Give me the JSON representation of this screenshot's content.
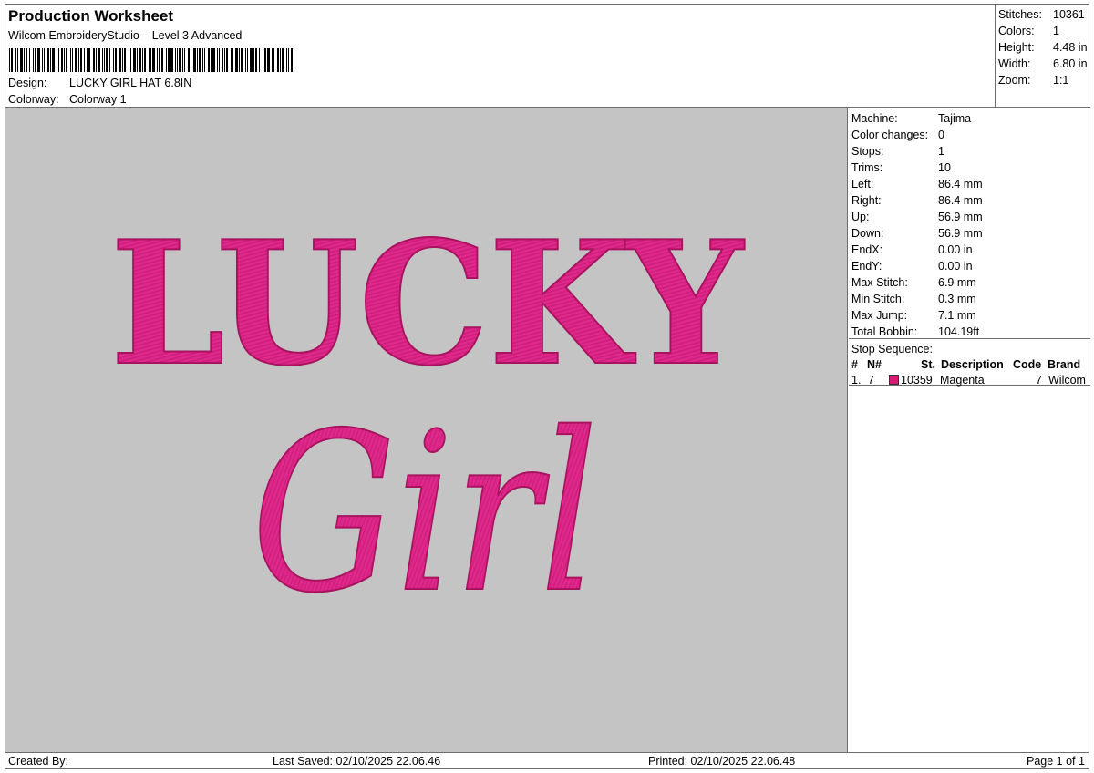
{
  "header": {
    "title": "Production Worksheet",
    "software": "Wilcom EmbroideryStudio – Level 3 Advanced",
    "design_label": "Design:",
    "design_value": "LUCKY GIRL HAT 6.8IN",
    "colorway_label": "Colorway:",
    "colorway_value": "Colorway 1"
  },
  "summary": [
    {
      "label": "Stitches:",
      "value": "10361"
    },
    {
      "label": "Colors:",
      "value": "1"
    },
    {
      "label": "Height:",
      "value": "4.48 in"
    },
    {
      "label": "Width:",
      "value": "6.80 in"
    },
    {
      "label": "Zoom:",
      "value": "1:1"
    }
  ],
  "preview": {
    "line1": "LUCKY",
    "line2": "Girl",
    "thread_color": "#e0278a",
    "background_color": "#c4c4c4"
  },
  "machine_info": [
    {
      "label": "Machine:",
      "value": "Tajima"
    },
    {
      "label": "Color changes:",
      "value": "0"
    },
    {
      "label": "Stops:",
      "value": "1"
    },
    {
      "label": "Trims:",
      "value": "10"
    },
    {
      "label": "Left:",
      "value": "86.4 mm"
    },
    {
      "label": "Right:",
      "value": "86.4 mm"
    },
    {
      "label": "Up:",
      "value": "56.9 mm"
    },
    {
      "label": "Down:",
      "value": "56.9 mm"
    },
    {
      "label": "EndX:",
      "value": "0.00 in"
    },
    {
      "label": "EndY:",
      "value": "0.00 in"
    },
    {
      "label": "Max Stitch:",
      "value": "6.9 mm"
    },
    {
      "label": "Min Stitch:",
      "value": "0.3 mm"
    },
    {
      "label": "Max Jump:",
      "value": "7.1 mm"
    },
    {
      "label": "Total Bobbin:",
      "value": "104.19ft"
    }
  ],
  "stop_sequence": {
    "title": "Stop Sequence:",
    "columns": {
      "num": "#",
      "n": "N#",
      "st": "St.",
      "description": "Description",
      "code": "Code",
      "brand": "Brand"
    },
    "rows": [
      {
        "num": "1.",
        "n": "7",
        "swatch": "#d81b72",
        "st": "10359",
        "description": "Magenta",
        "code": "7",
        "brand": "Wilcom"
      }
    ]
  },
  "footer": {
    "created_by": "Created By:",
    "last_saved": "Last Saved: 02/10/2025 22.06.46",
    "printed": "Printed: 02/10/2025 22.06.48",
    "page": "Page 1 of 1"
  }
}
